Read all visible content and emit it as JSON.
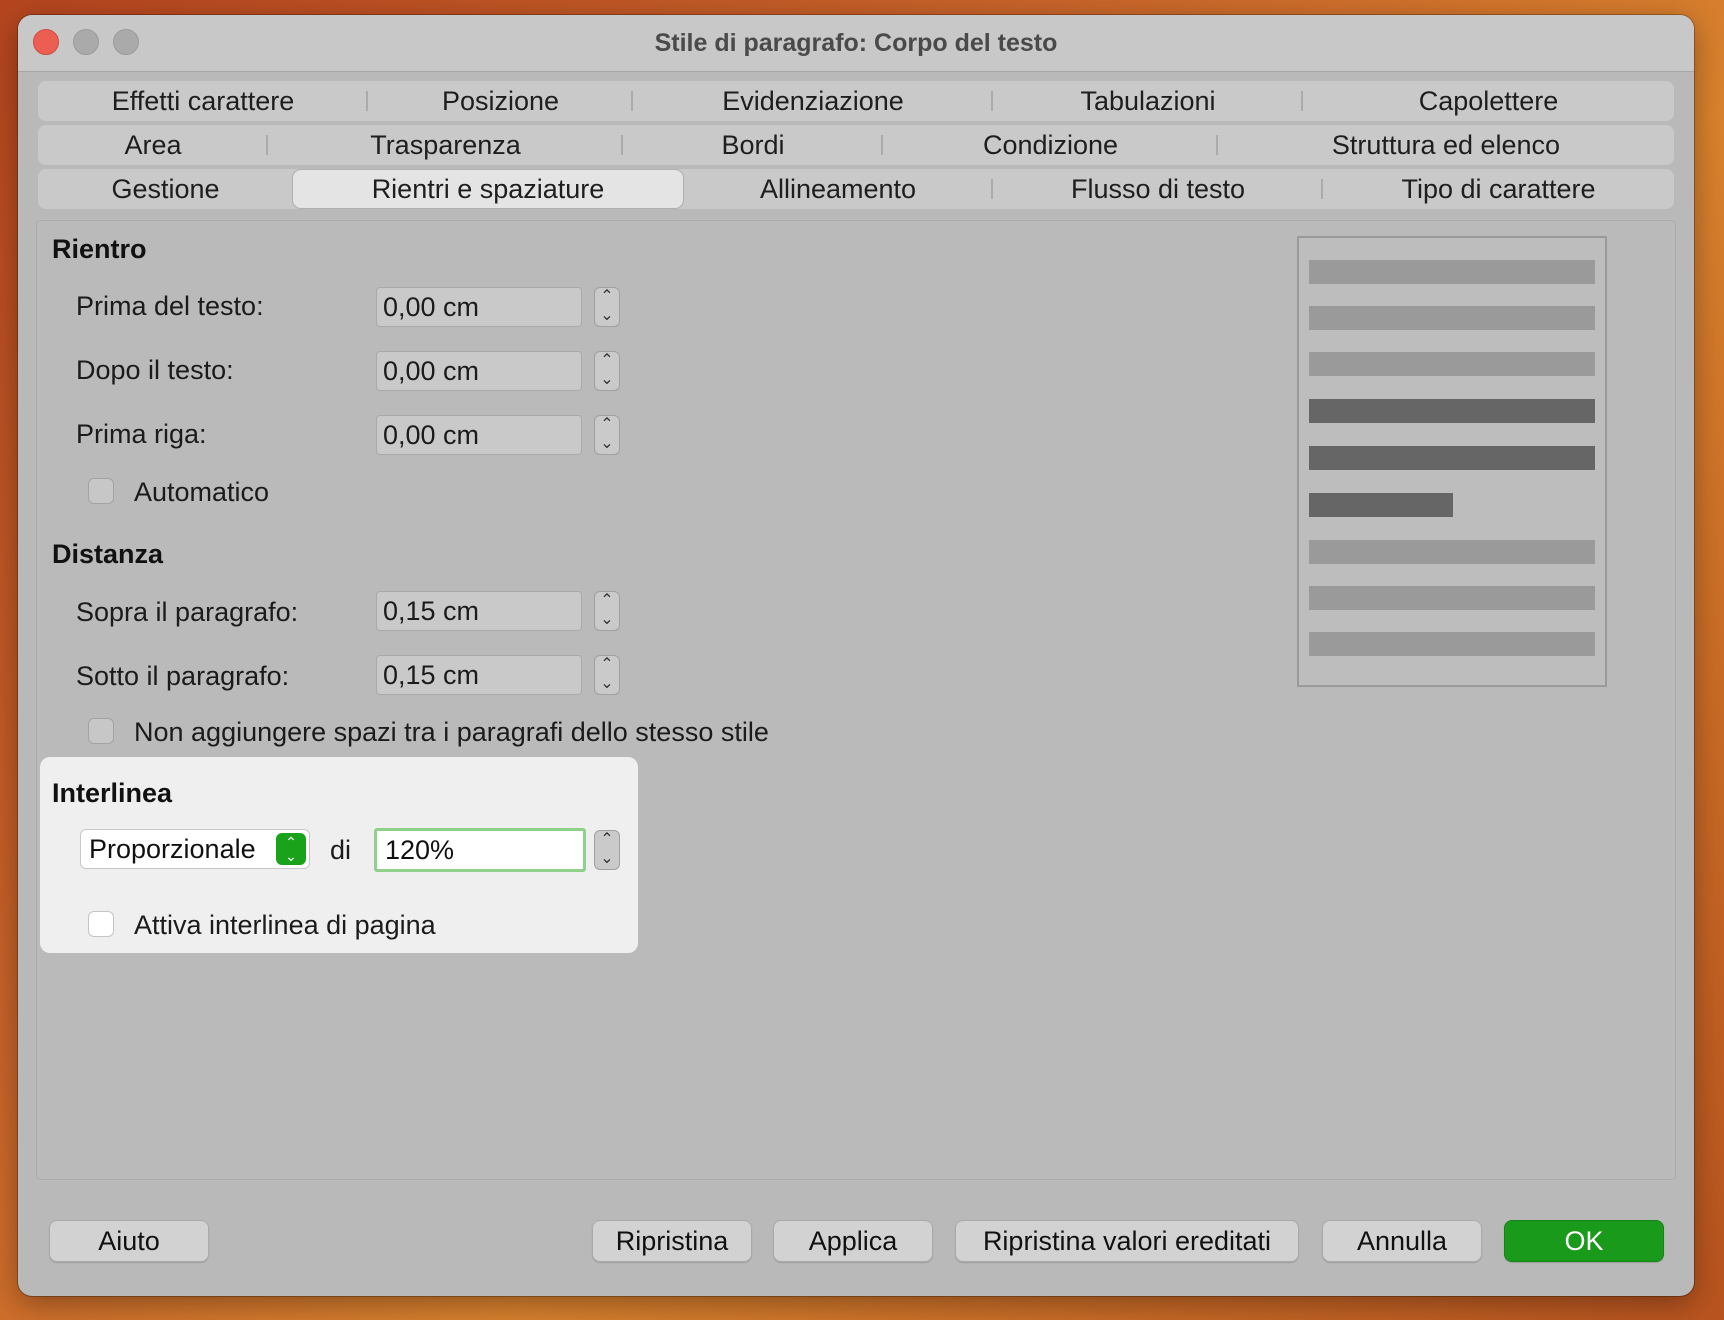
{
  "window": {
    "title": "Stile di paragrafo: Corpo del testo"
  },
  "tabs": {
    "row1": [
      "Effetti carattere",
      "Posizione",
      "Evidenziazione",
      "Tabulazioni",
      "Capolettere"
    ],
    "row2": [
      "Area",
      "Trasparenza",
      "Bordi",
      "Condizione",
      "Struttura ed elenco"
    ],
    "row3": [
      "Gestione",
      "Rientri e spaziature",
      "Allineamento",
      "Flusso di testo",
      "Tipo di carattere"
    ],
    "active": "Rientri e spaziature"
  },
  "rientro": {
    "heading": "Rientro",
    "prima_del_testo": {
      "label": "Prima del testo:",
      "value": "0,00 cm"
    },
    "dopo_il_testo": {
      "label": "Dopo il testo:",
      "value": "0,00 cm"
    },
    "prima_riga": {
      "label": "Prima riga:",
      "value": "0,00 cm"
    },
    "automatico": {
      "label": "Automatico",
      "checked": false
    }
  },
  "distanza": {
    "heading": "Distanza",
    "sopra": {
      "label": "Sopra il paragrafo:",
      "value": "0,15 cm"
    },
    "sotto": {
      "label": "Sotto il paragrafo:",
      "value": "0,15 cm"
    },
    "non_aggiungere": {
      "label": "Non aggiungere spazi tra i paragrafi dello stesso stile",
      "checked": false
    }
  },
  "interlinea": {
    "heading": "Interlinea",
    "mode": "Proporzionale",
    "di_label": "di",
    "value": "120%",
    "attiva": {
      "label": "Attiva interlinea di pagina",
      "checked": false
    }
  },
  "buttons": {
    "aiuto": "Aiuto",
    "ripristina": "Ripristina",
    "applica": "Applica",
    "ripristina_ereditati": "Ripristina valori ereditati",
    "annulla": "Annulla",
    "ok": "OK"
  },
  "icons": {
    "spin": "spin-arrows-icon",
    "select": "select-chevrons-icon",
    "close": "close-traffic-light-icon"
  },
  "colors": {
    "accent": "#1a9a1a",
    "focus": "#8fd08b",
    "close_light": "#ec5e52"
  }
}
